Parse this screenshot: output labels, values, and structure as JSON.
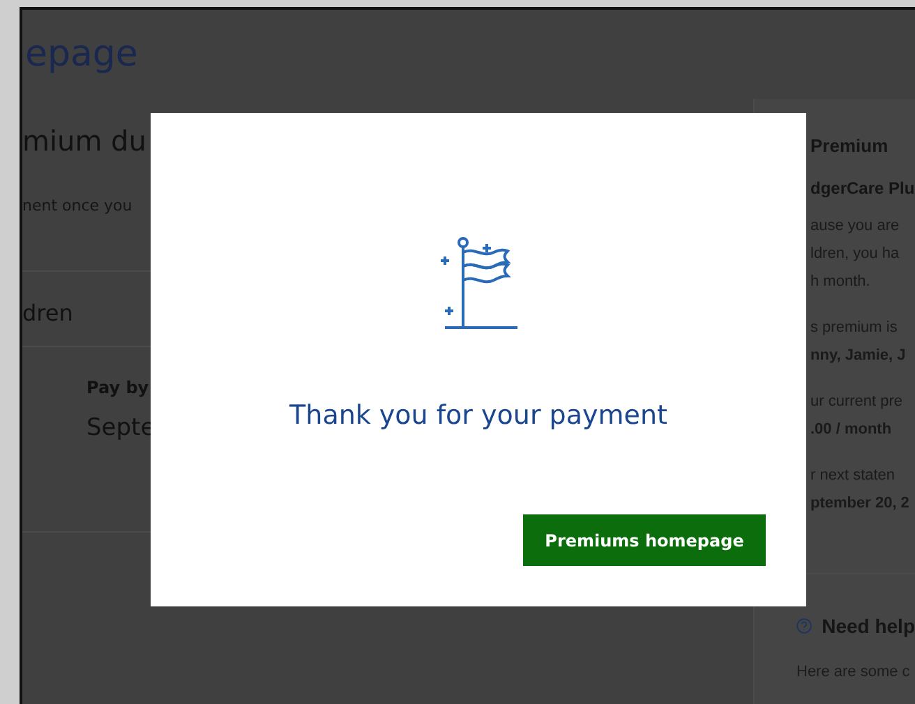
{
  "page": {
    "title": "epage",
    "main": {
      "heading": "mium du",
      "note": "nent once you",
      "section": "dren",
      "pay_label": "Pay by",
      "pay_value": "Septe"
    },
    "side": {
      "title": "Premium",
      "plan": "dgerCare Plu",
      "lines": [
        {
          "text": "ause you are",
          "bold": false
        },
        {
          "text": "ldren, you ha",
          "bold": false
        },
        {
          "text": "h month.",
          "bold": false
        }
      ],
      "facts": [
        {
          "label": "s premium is",
          "value": "nny, Jamie, J"
        },
        {
          "label": "ur current pre",
          "value": ".00 / month"
        },
        {
          "label": "r next staten",
          "value": "ptember 20, 2"
        }
      ],
      "help": {
        "title": "Need help",
        "text": "Here are some c"
      }
    }
  },
  "dialog": {
    "title": "Thank you for your payment",
    "button": "Premiums homepage"
  }
}
